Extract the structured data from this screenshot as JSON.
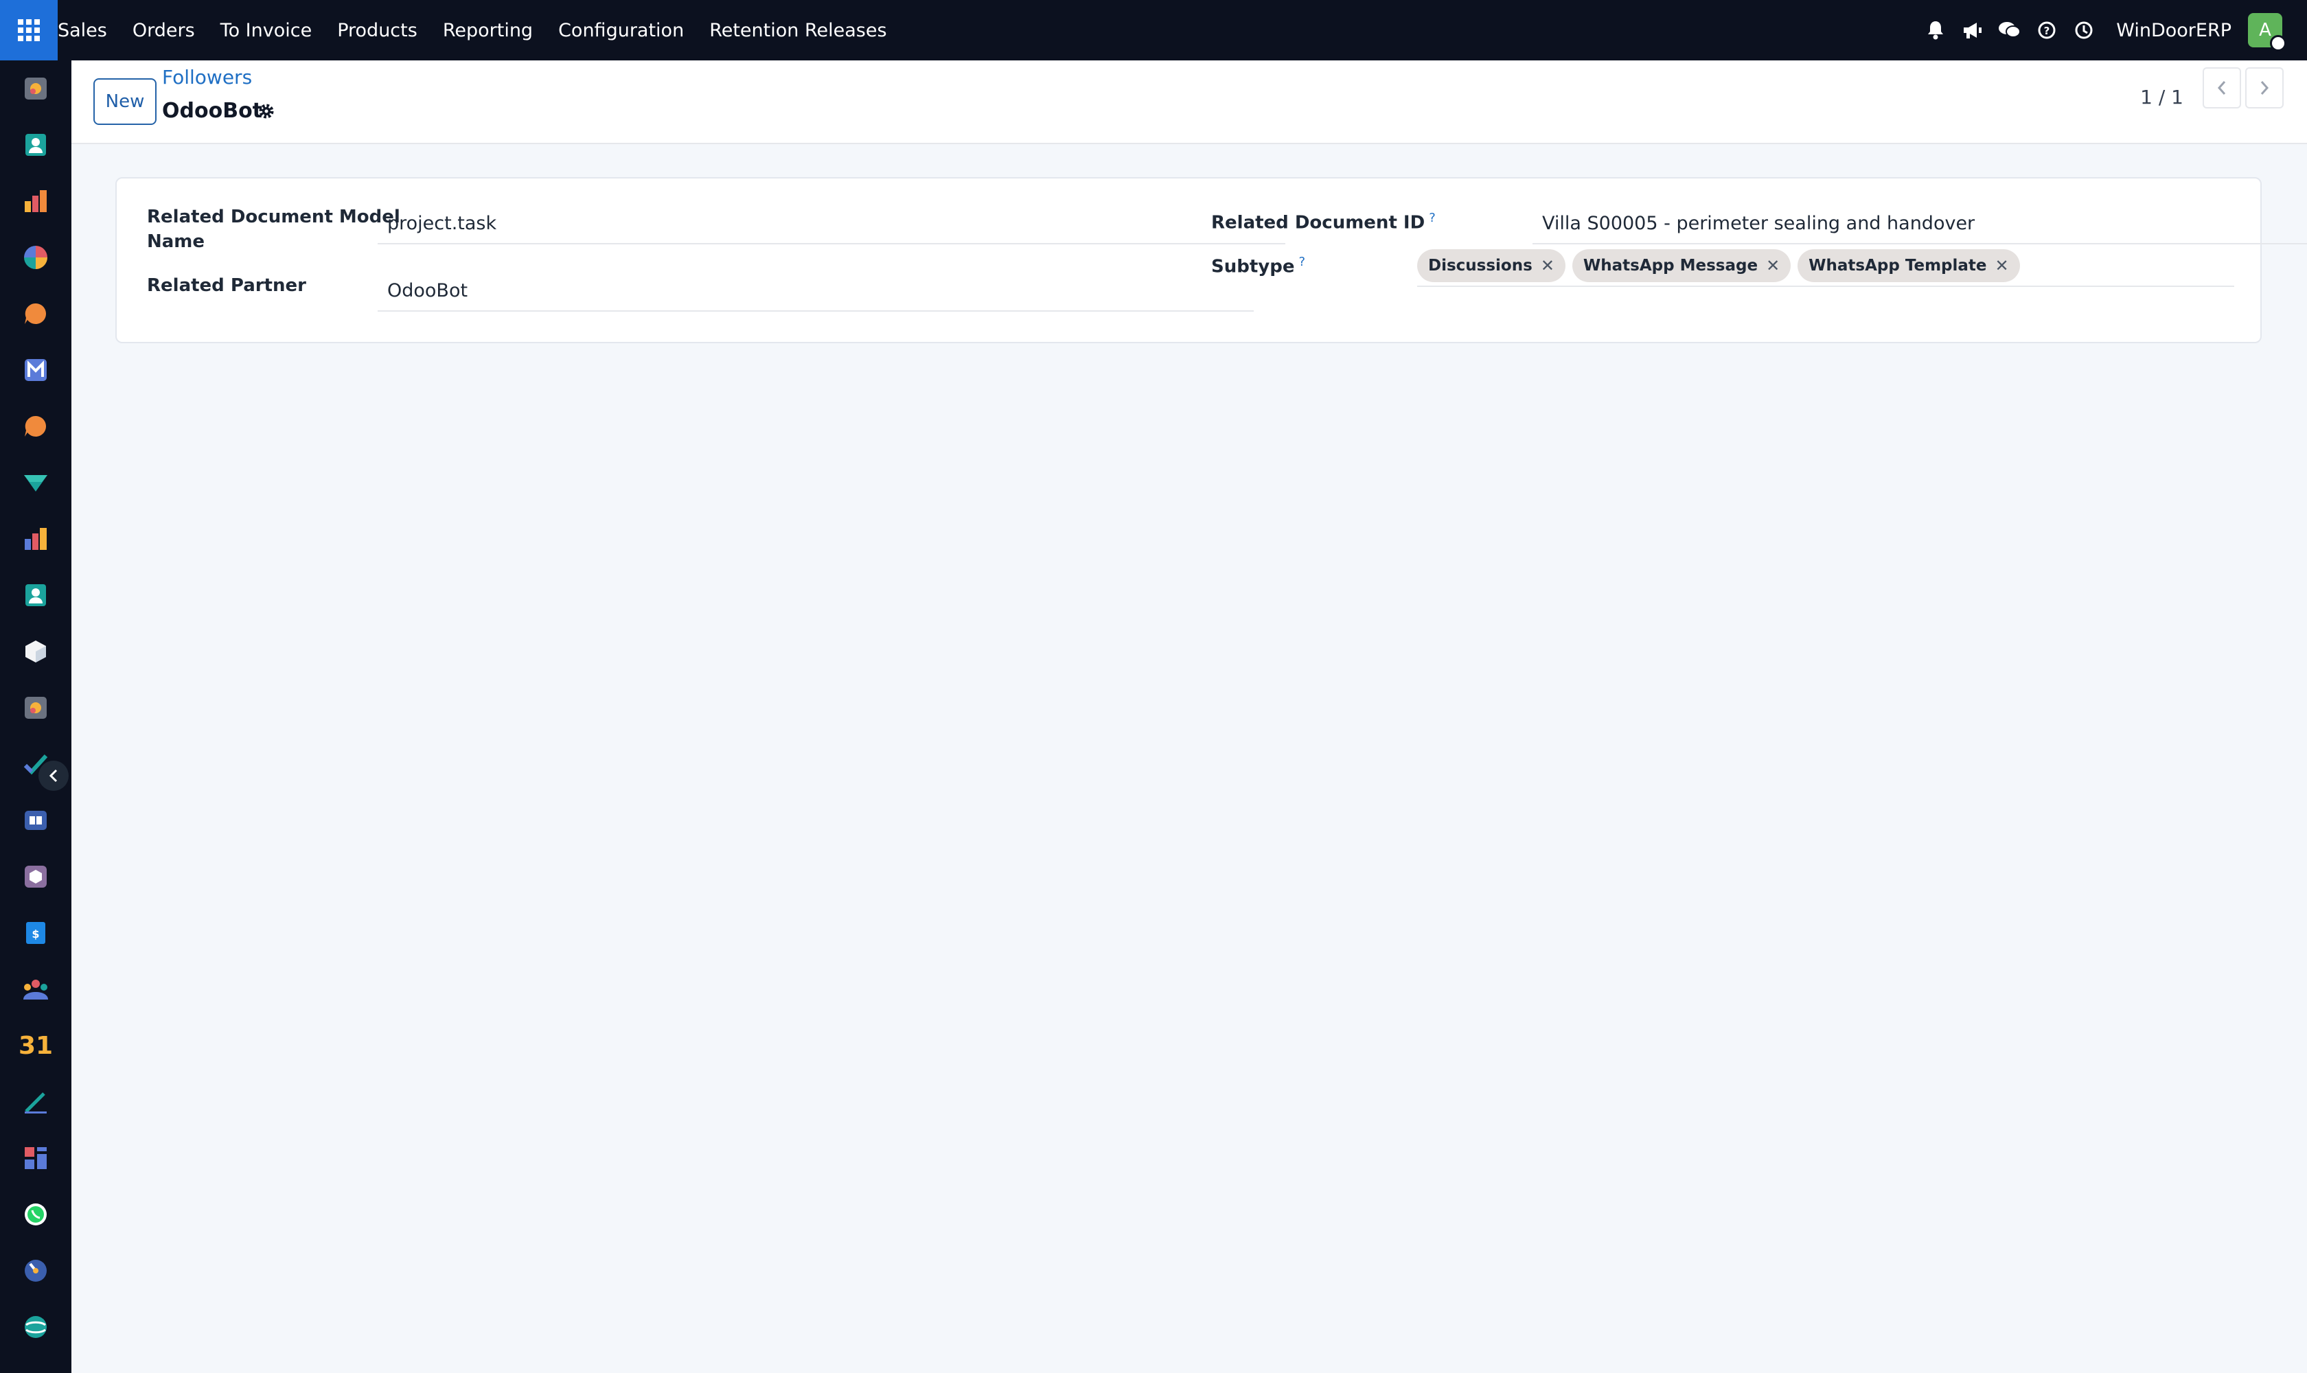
{
  "topbar": {
    "menu": [
      "Sales",
      "Orders",
      "To Invoice",
      "Products",
      "Reporting",
      "Configuration",
      "Retention Releases"
    ],
    "icons": [
      "bell-icon",
      "megaphone-icon",
      "chat-icon",
      "help-icon",
      "clock-icon"
    ],
    "company": "WinDoorERP",
    "avatar_letter": "A"
  },
  "sidebar": {
    "apps": [
      "crm-app",
      "contacts-app",
      "reporting-app",
      "dashboard-app",
      "discuss-app",
      "email-marketing-app",
      "chat-app",
      "sign-app",
      "spreadsheet-app",
      "employees-app",
      "inventory-app",
      "crm-app-2",
      "project-app",
      "knowledge-app",
      "manufacturing-app",
      "invoicing-app",
      "team-app",
      "calendar-app",
      "notes-app",
      "widgets-app",
      "whatsapp-app",
      "timer-app",
      "odoo-app"
    ],
    "calendar_label": "31"
  },
  "control_panel": {
    "new_label": "New",
    "breadcrumb": "Followers",
    "record_name": "OdooBot",
    "pager": "1 / 1"
  },
  "form": {
    "model_name_label_line1": "Related Document Model",
    "model_name_label_line2": "Name",
    "model_name_value": "project.task",
    "partner_label": "Related Partner",
    "partner_value": "OdooBot",
    "doc_id_label": "Related Document ID",
    "doc_id_value": "Villa S00005 - perimeter sealing and handover",
    "subtype_label": "Subtype",
    "help_mark": "?",
    "subtypes": [
      "Discussions",
      "WhatsApp Message",
      "WhatsApp Template"
    ],
    "tag_remove": "✕"
  },
  "colors": {
    "navbar": "#0c111f",
    "apps_button": "#1e6fd9",
    "link": "#1f6fc4",
    "avatar": "#5fb45a",
    "tag_bg": "#e5e1df"
  }
}
